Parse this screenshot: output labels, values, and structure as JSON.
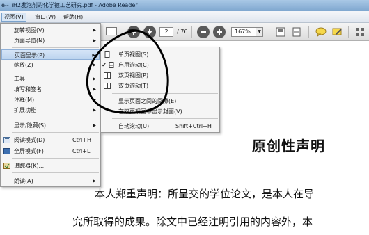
{
  "window": {
    "title": "e--TiH2发泡剂的化学镀工艺研究.pdf - Adobe Reader"
  },
  "menubar": {
    "items": [
      {
        "label": "视图(V)"
      },
      {
        "label": "窗口(W)"
      },
      {
        "label": "帮助(H)"
      }
    ]
  },
  "toolbar": {
    "page_current": "2",
    "page_total": "/ 76",
    "zoom": "167%"
  },
  "view_menu": {
    "items": [
      {
        "label": "旋转视图(V)",
        "submenu": true
      },
      {
        "label": "页面导览(N)",
        "submenu": true
      },
      {
        "label": "页面显示(P)",
        "submenu": true
      },
      {
        "label": "缩放(Z)",
        "submenu": true
      },
      {
        "label": "工具",
        "submenu": true
      },
      {
        "label": "填写和签名",
        "submenu": true
      },
      {
        "label": "注释(M)",
        "submenu": true
      },
      {
        "label": "扩展功能",
        "submenu": true
      },
      {
        "label": "显示/隐藏(S)",
        "submenu": true
      },
      {
        "label": "阅读模式(D)",
        "shortcut": "Ctrl+H"
      },
      {
        "label": "全屏模式(F)",
        "shortcut": "Ctrl+L"
      },
      {
        "label": "追踪器(K)..."
      },
      {
        "label": "朗读(A)",
        "submenu": true
      }
    ]
  },
  "page_display_menu": {
    "items": [
      {
        "label": "单页视图(S)"
      },
      {
        "label": "启用滚动(C)",
        "checked": true
      },
      {
        "label": "双页视图(P)"
      },
      {
        "label": "双页滚动(T)"
      },
      {
        "label": "显示页面之间的间隙(E)"
      },
      {
        "label": "在双页视图中显示封面(V)"
      },
      {
        "label": "自动滚动(U)",
        "shortcut": "Shift+Ctrl+H"
      }
    ]
  },
  "document": {
    "heading": "原创性声明",
    "line1": "本人郑重声明：所呈交的学位论文，是本人在导",
    "line2": "究所取得的成果。除文中已经注明引用的内容外，本"
  },
  "colors": {
    "titlebar": "#8fb3d9",
    "menu_highlight": "#c6dbf2",
    "annotation_ink": "#000000"
  }
}
